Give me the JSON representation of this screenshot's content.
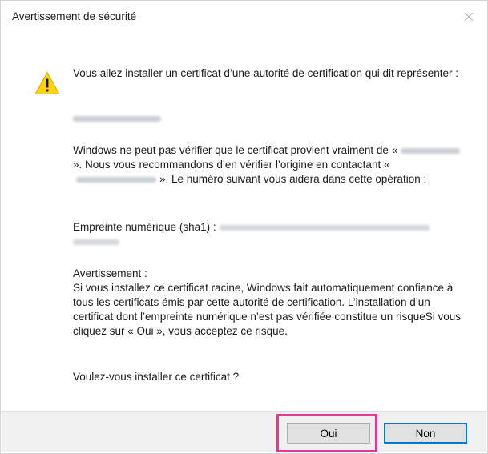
{
  "window": {
    "title": "Avertissement de sécurité"
  },
  "message": {
    "intro": "Vous allez installer un certificat d’une autorité de certification qui dit représenter :",
    "verify_part1": "Windows ne peut pas vérifier que le certificat provient vraiment de «",
    "verify_part2": "». Nous vous recommandons d’en vérifier l’origine en contactant «",
    "verify_part3": "». Le numéro suivant vous aidera dans cette opération :",
    "thumbprint_label": "Empreinte numérique (sha1) :",
    "warning_heading": "Avertissement :",
    "warning_body": "Si vous installez ce certificat racine, Windows fait automatiquement confiance à tous les certificats émis par cette autorité de certification. L’installation d’un certificat dont l’empreinte numérique n’est pas vérifiée constitue un risqueSi vous cliquez sur « Oui », vous acceptez ce risque.",
    "question": "Voulez-vous installer ce certificat ?"
  },
  "buttons": {
    "yes": "Oui",
    "no": "Non"
  },
  "icons": {
    "warning": "warning-icon",
    "close": "close-icon"
  },
  "colors": {
    "highlight": "#e8388f",
    "default_button_border": "#0078d7",
    "warning_yellow": "#fcd116"
  }
}
